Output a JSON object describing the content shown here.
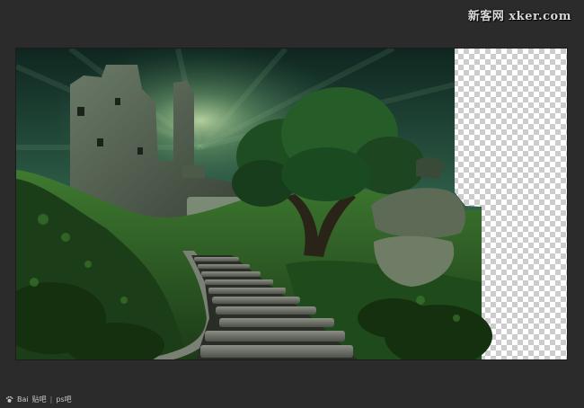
{
  "watermark_top": {
    "site": "新客网 xker.com"
  },
  "watermark_bottom": {
    "brand": "Bai",
    "brand_suffix": "贴吧",
    "separator": "|",
    "forum": "ps吧"
  },
  "canvas": {
    "transparency_checker_colors": [
      "#ffffff",
      "#cccccc"
    ],
    "sky_color": "#1f3d33",
    "grass_color": "#2f6a2a"
  }
}
